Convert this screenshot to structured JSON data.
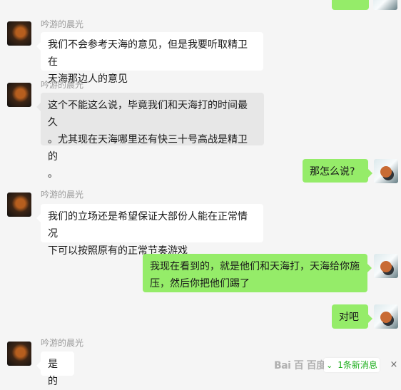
{
  "colors": {
    "background": "#f5f5f5",
    "incoming_bubble": "#ffffff",
    "outgoing_bubble": "#95ec69",
    "selected_bubble": "#e7e7e7",
    "sender_name": "#9a9a9a",
    "new_message_text": "#1aad19"
  },
  "messages": [
    {
      "direction": "incoming",
      "sender": "吟游的晨光",
      "text": "我们不会参考天海的意见，但是我要听取精卫在\n天海那边人的意见",
      "avatar_icon": "avatar-icon"
    },
    {
      "direction": "incoming",
      "sender": "吟游的晨光",
      "text": "这个不能这么说，毕竟我们和天海打的时间最久\n。尤其现在天海哪里还有快三十号高战是精卫的\n。",
      "avatar_icon": "avatar-icon"
    },
    {
      "direction": "outgoing",
      "text": "那怎么说?",
      "avatar_icon": "avatar-icon"
    },
    {
      "direction": "incoming",
      "sender": "吟游的晨光",
      "text": "我们的立场还是希望保证大部份人能在正常情况\n下可以按照原有的正常节奏游戏",
      "avatar_icon": "avatar-icon"
    },
    {
      "direction": "outgoing",
      "text": "我现在看到的，就是他们和天海打，天海给你施\n压，然后你把他们踢了",
      "avatar_icon": "avatar-icon"
    },
    {
      "direction": "outgoing",
      "text": "对吧",
      "avatar_icon": "avatar-icon"
    },
    {
      "direction": "incoming",
      "sender": "吟游的晨光",
      "text": "是的",
      "avatar_icon": "avatar-icon"
    }
  ],
  "new_message_notice": {
    "icon": "chevron-down-icon",
    "label": "1条新消息"
  },
  "watermark": {
    "text": "Bai 百 百度"
  },
  "close_icon": "close-icon"
}
